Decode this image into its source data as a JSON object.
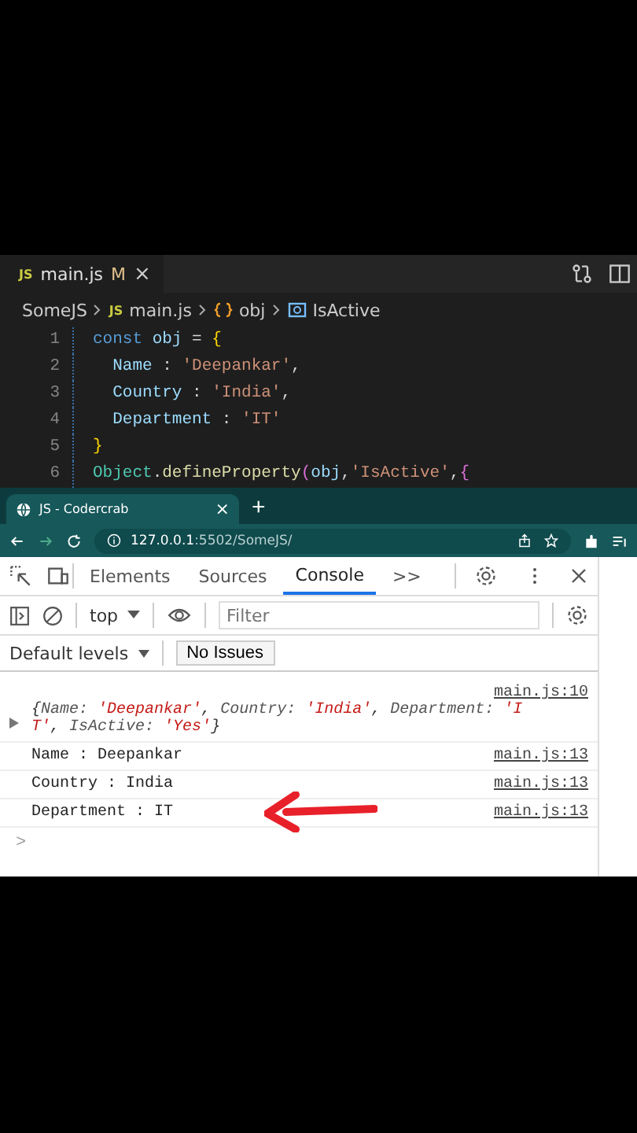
{
  "editor": {
    "tab": {
      "icon_text": "JS",
      "name": "main.js",
      "badge": "M",
      "close": "×"
    },
    "breadcrumb": [
      {
        "kind": "folder",
        "label": "SomeJS"
      },
      {
        "kind": "file",
        "icon_text": "JS",
        "label": "main.js"
      },
      {
        "kind": "object",
        "label": "obj"
      },
      {
        "kind": "property",
        "label": "IsActive"
      }
    ],
    "lines": [
      {
        "number": "1",
        "tokens": [
          {
            "kind": "keyword",
            "text": "const "
          },
          {
            "kind": "variable",
            "text": "obj"
          },
          {
            "kind": "punct",
            "text": " = "
          },
          {
            "kind": "brace",
            "text": "{"
          }
        ]
      },
      {
        "number": "2",
        "tokens": [
          {
            "kind": "property",
            "text": "  Name"
          },
          {
            "kind": "punct",
            "text": " : "
          },
          {
            "kind": "string",
            "text": "'Deepankar'"
          },
          {
            "kind": "punct",
            "text": ","
          }
        ]
      },
      {
        "number": "3",
        "tokens": [
          {
            "kind": "property",
            "text": "  Country"
          },
          {
            "kind": "punct",
            "text": " : "
          },
          {
            "kind": "string",
            "text": "'India'"
          },
          {
            "kind": "punct",
            "text": ","
          }
        ]
      },
      {
        "number": "4",
        "tokens": [
          {
            "kind": "property",
            "text": "  Department"
          },
          {
            "kind": "punct",
            "text": " : "
          },
          {
            "kind": "string",
            "text": "'IT'"
          }
        ]
      },
      {
        "number": "5",
        "tokens": [
          {
            "kind": "brace",
            "text": "}"
          }
        ]
      },
      {
        "number": "6",
        "tokens": [
          {
            "kind": "class",
            "text": "Object"
          },
          {
            "kind": "punct",
            "text": "."
          },
          {
            "kind": "function",
            "text": "defineProperty"
          },
          {
            "kind": "paren",
            "text": "("
          },
          {
            "kind": "variable",
            "text": "obj"
          },
          {
            "kind": "punct",
            "text": ","
          },
          {
            "kind": "string",
            "text": "'IsActive'"
          },
          {
            "kind": "punct",
            "text": ","
          },
          {
            "kind": "paren2",
            "text": "{"
          }
        ]
      }
    ]
  },
  "browser": {
    "tab": {
      "title": "JS - Codercrab",
      "close": "×"
    },
    "new_tab": "+",
    "url": "**127.0.0.1**:5502/SomeJS/",
    "devtools": {
      "tabs": [
        {
          "label": "Elements",
          "selected": false
        },
        {
          "label": "Sources",
          "selected": false
        },
        {
          "label": "Console",
          "selected": true
        }
      ],
      "more": ">>",
      "context": "top",
      "filter": {
        "placeholder": "Filter"
      },
      "levels": "Default levels",
      "issues": "No Issues",
      "messages": [
        {
          "kind": "object",
          "source": "main.js:10",
          "tokens": [
            {
              "kind": "punct",
              "text": "{"
            },
            {
              "kind": "key",
              "text": "Name: "
            },
            {
              "kind": "string",
              "text": "'Deepankar'"
            },
            {
              "kind": "punct",
              "text": ", "
            },
            {
              "kind": "key",
              "text": "Country: "
            },
            {
              "kind": "string",
              "text": "'India'"
            },
            {
              "kind": "punct",
              "text": ", "
            },
            {
              "kind": "key",
              "text": "Department: "
            },
            {
              "kind": "string",
              "text": "'IT'"
            },
            {
              "kind": "punct",
              "text": ", "
            },
            {
              "kind": "key",
              "text": "IsActive: "
            },
            {
              "kind": "string",
              "text": "'Yes'"
            },
            {
              "kind": "punct",
              "text": "}"
            }
          ]
        },
        {
          "kind": "log",
          "source": "main.js:13",
          "text": "Name : Deepankar"
        },
        {
          "kind": "log",
          "source": "main.js:13",
          "text": "Country : India"
        },
        {
          "kind": "log",
          "source": "main.js:13",
          "text": "Department : IT"
        }
      ],
      "prompt": ">"
    }
  }
}
